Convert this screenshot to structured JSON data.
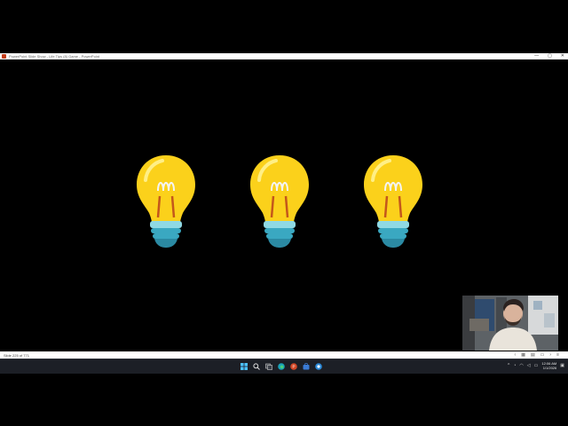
{
  "window": {
    "title": "PowerPoint Slide Show  -  Life Tips (8) Game  -  PowerPoint",
    "minimize": "—",
    "maximize": "▢",
    "close": "✕"
  },
  "status": {
    "slide_counter": "Slide 225 of 771"
  },
  "taskbar": {
    "time": "12:06 AM",
    "date": "1/1/2026",
    "tray_arrow": "^"
  },
  "icons": [
    "lightbulb-icon",
    "windows-start-icon",
    "search-icon",
    "task-view-icon",
    "edge-icon",
    "powerpoint-icon",
    "store-icon"
  ],
  "colors": {
    "bulb_yellow": "#fbd11b",
    "bulb_base": "#3aa8c1",
    "taskbar": "#1c1f26",
    "accent": "#0078d4"
  }
}
